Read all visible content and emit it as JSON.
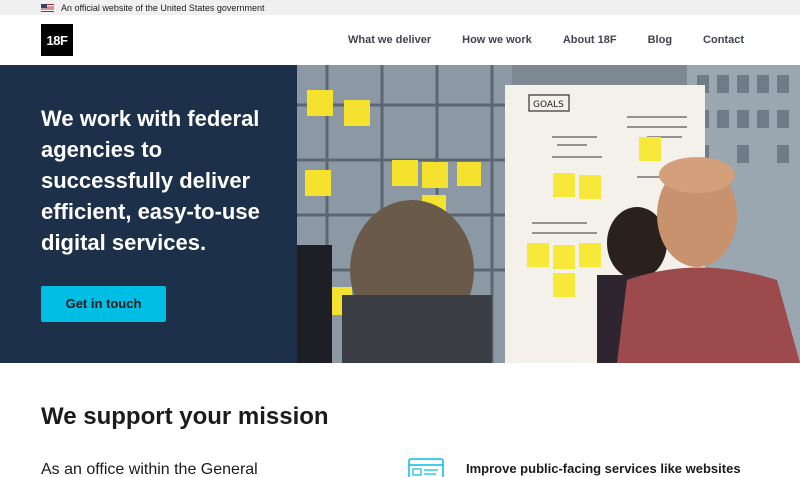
{
  "gov_banner": {
    "text": "An official website of the United States government"
  },
  "header": {
    "logo_text": "18F",
    "nav": [
      "What we deliver",
      "How we work",
      "About 18F",
      "Blog",
      "Contact"
    ]
  },
  "hero": {
    "title": "We work with federal agencies to successfully deliver efficient, easy-to-use digital services.",
    "cta_label": "Get in touch",
    "photo_board_heading": "GOALS"
  },
  "mission": {
    "title": "We support your mission",
    "intro": "As an office within the General",
    "service_title": "Improve public-facing services like websites"
  },
  "colors": {
    "hero_bg": "#1c304a",
    "cta_bg": "#00bde3",
    "gov_banner_bg": "#f0f0f0"
  },
  "icons": [
    "us-flag-icon",
    "website-icon"
  ]
}
